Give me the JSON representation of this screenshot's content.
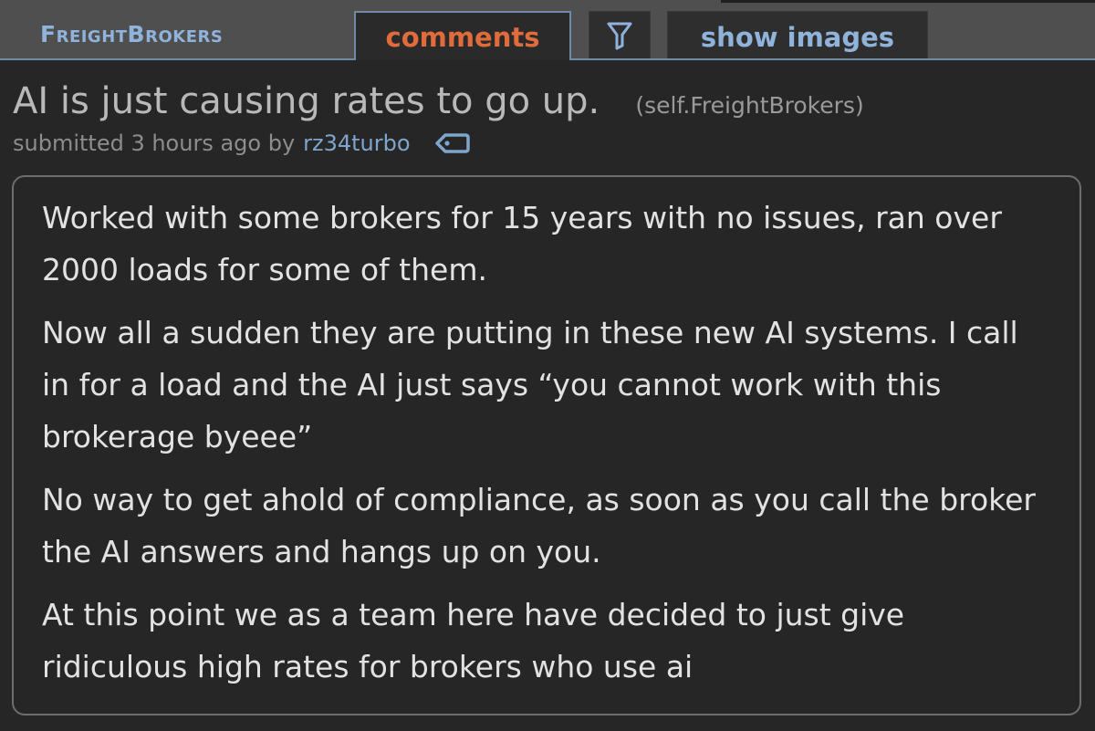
{
  "header": {
    "subreddit": "FreightBrokers",
    "tabs": {
      "comments": "comments",
      "show_images": "show images"
    }
  },
  "post": {
    "title": "AI is just causing rates to go up.",
    "domain": "(self.FreightBrokers)",
    "tagline": {
      "submitted": "submitted 3 hours ago by",
      "author": "rz34turbo"
    },
    "body": [
      "Worked with some brokers for 15 years with no issues, ran over 2000 loads for some of them.",
      "Now all a sudden they are putting in these new AI systems. I call in for a load and the AI just says “you cannot work with this brokerage byeee”",
      "No way to get ahold of compliance, as soon as you call the broker the AI answers and hangs up on you.",
      "At this point we as a team here have decided to just give ridiculous high rates for brokers who use ai"
    ]
  },
  "colors": {
    "background": "#262626",
    "header": "#4f4f4f",
    "accent_blue": "#8fb3da",
    "active_tab_text": "#e06c3c",
    "author_link": "#7ea5cc"
  },
  "icons": {
    "filter": "funnel-icon",
    "tag": "tag-icon"
  }
}
